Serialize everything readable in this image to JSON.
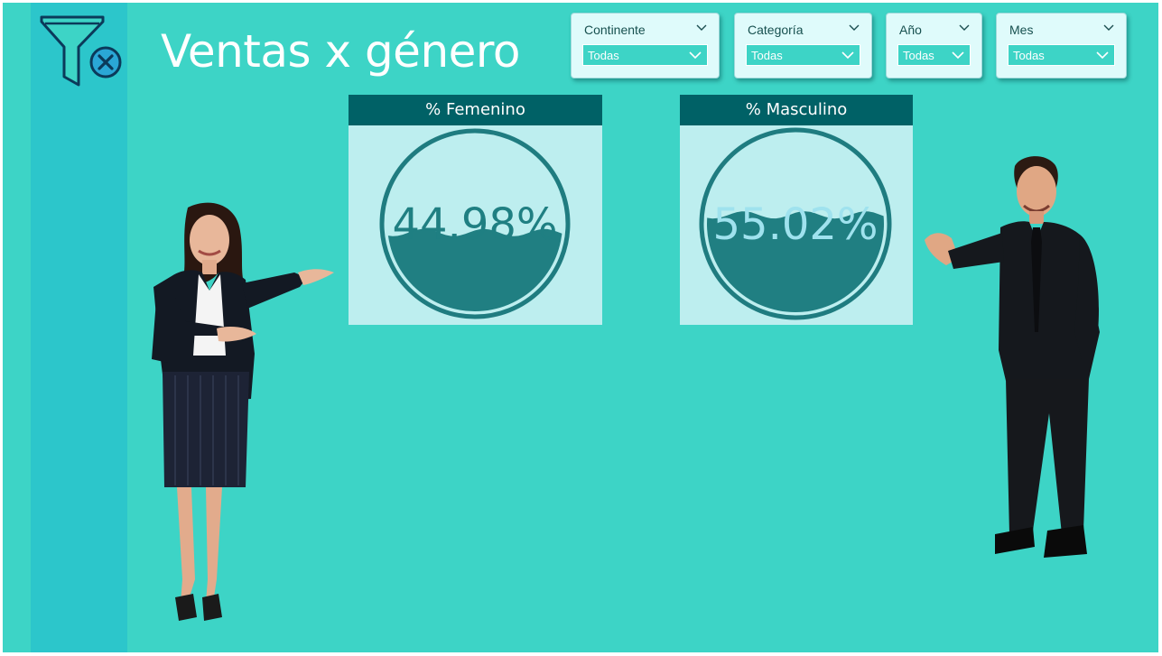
{
  "colors": {
    "background": "#3dd4c6",
    "rail": "#2cc6cb",
    "header": "#006166",
    "liquid": "#207f82",
    "ring": "#1f7c80",
    "card": "#bdeeef",
    "female_value_text": "#1f7f82",
    "male_value_text": "#9fe2ee"
  },
  "header": {
    "title": "Ventas x género",
    "clear_filters_icon": "funnel-clear-icon"
  },
  "slicers": [
    {
      "label": "Continente",
      "value": "Todas"
    },
    {
      "label": "Categoría",
      "value": "Todas"
    },
    {
      "label": "Año",
      "value": "Todas"
    },
    {
      "label": "Mes",
      "value": "Todas"
    }
  ],
  "gauges": {
    "female": {
      "title": "% Femenino",
      "value_text": "44.98%",
      "fill": 0.4498
    },
    "male": {
      "title": "% Masculino",
      "value_text": "55.02%",
      "fill": 0.5502
    }
  },
  "images": {
    "female": "businesswoman-presenting",
    "male": "businessman-presenting"
  }
}
